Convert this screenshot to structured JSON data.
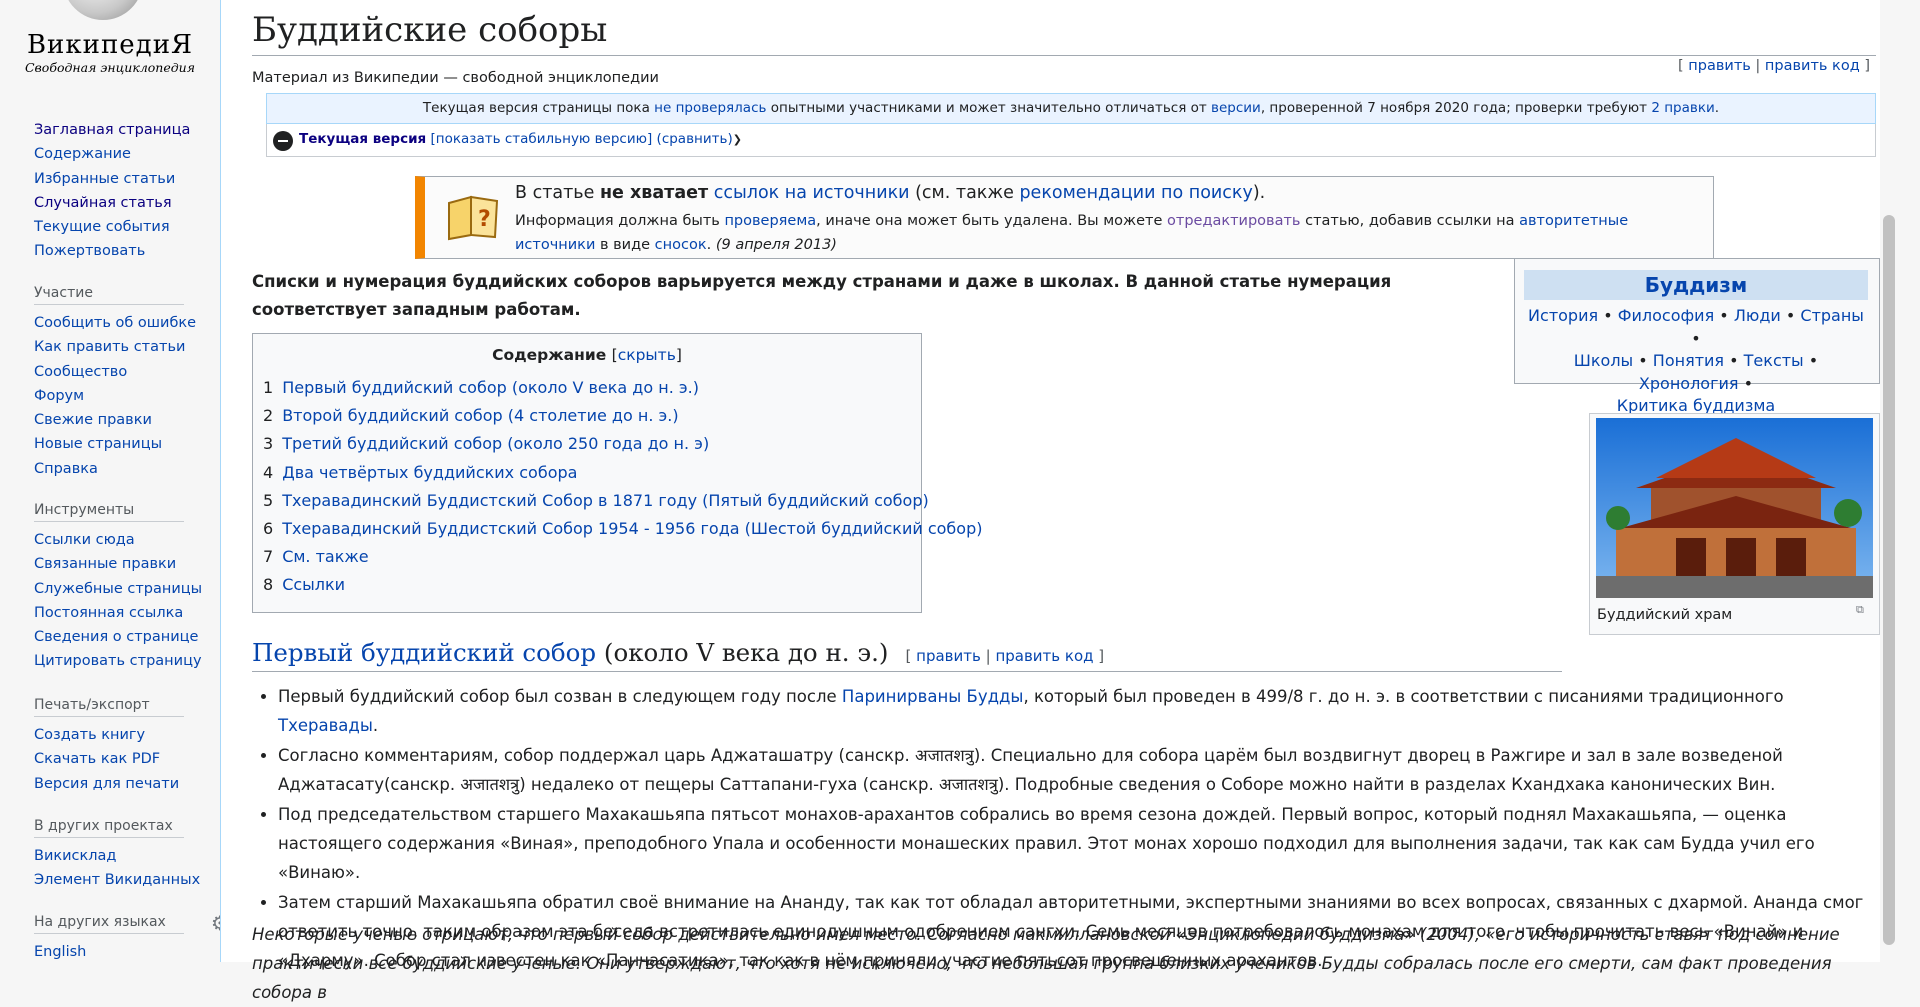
{
  "logo": {
    "wordmark": "ВикипедиЯ",
    "tagline": "Свободная энциклопедия"
  },
  "sidebar": {
    "main_links": [
      "Заглавная страница",
      "Содержание",
      "Избранные статьи",
      "Случайная статья",
      "Текущие события",
      "Пожертвовать"
    ],
    "participation": {
      "title": "Участие",
      "items": [
        "Сообщить об ошибке",
        "Как править статьи",
        "Сообщество",
        "Форум",
        "Свежие правки",
        "Новые страницы",
        "Справка"
      ]
    },
    "tools": {
      "title": "Инструменты",
      "items": [
        "Ссылки сюда",
        "Связанные правки",
        "Служебные страницы",
        "Постоянная ссылка",
        "Сведения о странице",
        "Цитировать страницу"
      ]
    },
    "print": {
      "title": "Печать/экспорт",
      "items": [
        "Создать книгу",
        "Скачать как PDF",
        "Версия для печати"
      ]
    },
    "projects": {
      "title": "В других проектах",
      "items": [
        "Викисклад",
        "Элемент Викиданных"
      ]
    },
    "languages": {
      "title": "На других языках",
      "items": [
        "English"
      ],
      "settings_icon": "gear-icon"
    }
  },
  "page": {
    "title": "Буддийские соборы",
    "subtitle": "Материал из Википедии — свободной энциклопедии",
    "edit_open": "[ ",
    "edit": "править",
    "sep": " | ",
    "edit_code": "править код",
    "edit_close": " ]"
  },
  "flagged": {
    "t1": "Текущая версия страницы пока ",
    "l1": "не проверялась",
    "t2": " опытными участниками и может значительно отличаться от ",
    "l2": "версии",
    "t3": ", проверенной 7 ноября 2020 года; проверки требуют ",
    "l3": "2 правки",
    "t4": ".",
    "current_label": "Текущая версия",
    "show_stable": "[показать стабильную версию]",
    "compare": "(сравнить)"
  },
  "ambox": {
    "l1_a": "В статье ",
    "l1_b": "не хватает",
    "l1_link": "ссылок на источники",
    "l1_c": " (см. также ",
    "l1_link2": "рекомендации по поиску",
    "l1_d": ").",
    "l2_a": "Информация должна быть ",
    "l2_link1": "проверяема",
    "l2_b": ", иначе она может быть удалена. Вы можете ",
    "l2_link2": "отредактировать",
    "l2_c": " статью, добавив ссылки на ",
    "l2_link3": "авторитетные источники",
    "l2_d": " в виде ",
    "l2_link4": "сносок",
    "l2_e": ". ",
    "l2_date": "(9 апреля 2013)"
  },
  "intro": "Списки и нумерация буддийских соборов варьируется между странами и даже в школах. В данной статье нумерация соответствует западным работам.",
  "toc": {
    "title": "Содержание",
    "hide": "скрыть",
    "items": [
      {
        "num": "1",
        "text": "Первый буддийский собор (около V века до н. э.)"
      },
      {
        "num": "2",
        "text": "Второй буддийский собор (4 столетие до н. э.)"
      },
      {
        "num": "3",
        "text": "Третий буддийский собор (около 250 года до н. э)"
      },
      {
        "num": "4",
        "text": "Два четвёртых буддийских собора"
      },
      {
        "num": "5",
        "text": "Тхеравадинский Буддистский Собор в 1871 году (Пятый буддийский собор)"
      },
      {
        "num": "6",
        "text": "Тхеравадинский Буддистский Собор 1954 - 1956 года (Шестой буддийский собор)"
      },
      {
        "num": "7",
        "text": "См. также"
      },
      {
        "num": "8",
        "text": "Ссылки"
      }
    ]
  },
  "navbox": {
    "title": "Буддизм",
    "links": [
      "История",
      "Философия",
      "Люди",
      "Страны",
      "Школы",
      "Понятия",
      "Тексты",
      "Хронология",
      "Критика буддизма"
    ],
    "bullet": " • "
  },
  "thumb": {
    "caption": "Буддийский храм"
  },
  "section1": {
    "title_link": "Первый буддийский собор",
    "title_rest": " (около V века до н. э.)",
    "edit": "править",
    "edit_code": "править код"
  },
  "bullets": {
    "b1_a": "Первый буддийский собор был созван в следующем году после ",
    "b1_link1": "Паринирваны Будды",
    "b1_b": ", который был проведен в 499/8 г. до н. э. в соответствии с писаниями традиционного ",
    "b1_link2": "Тхеравады",
    "b1_c": ".",
    "b2": "Согласно комментариям, собор поддержал царь Аджаташатру (санскр. अजातशत्रु). Специально для собора царём был воздвигнут дворец в Ражгире и зал в зале возведеной Аджатасату(санскр. अजातशत्रु) недалеко от пещеры Саттапани-гуха (санскр. अजातशत्रु). Подробные сведения о Соборе можно найти в разделах Кхандхака канонических Вин.",
    "b3": "Под председательством старшего Махакашьяпа пятьсот монахов-арахантов собрались во время сезона дождей. Первый вопрос, который поднял Махакашьяпа, — оценка настоящего содержания «Виная», преподобного Упала и особенности монашеских правил. Этот монах хорошо подходил для выполнения задачи, так как сам Будда учил его «Винаю».",
    "b4": "Затем старший Махакашьяпа обратил своё внимание на Ананду, так как тот обладал авторитетными, экспертными знаниями во всех вопросах, связанных с дхармой. Ананда смог ответить точно, таким образом эта беседа встретилась единодушным одобрением сангхи. Семь месяцев потребовалось монахам для того, чтобы прочитать весь «Винай» и «Дхарму». Собор стал известен как «Панчасатика», так как в нём приняли участие пятьсот просвещенных арахантов."
  },
  "italic_para": "Некоторые ученые отрицают, что первый собор действительно имел место. Согласно макмиллановской «Энциклопедии буддизма» (2004), «его историчность ставят под сомнение практически все буддийские ученые. Они утверждают, что хотя не исключено, что небольшая группа близких учеников Будды собралась после его смерти, сам факт проведения собора в"
}
